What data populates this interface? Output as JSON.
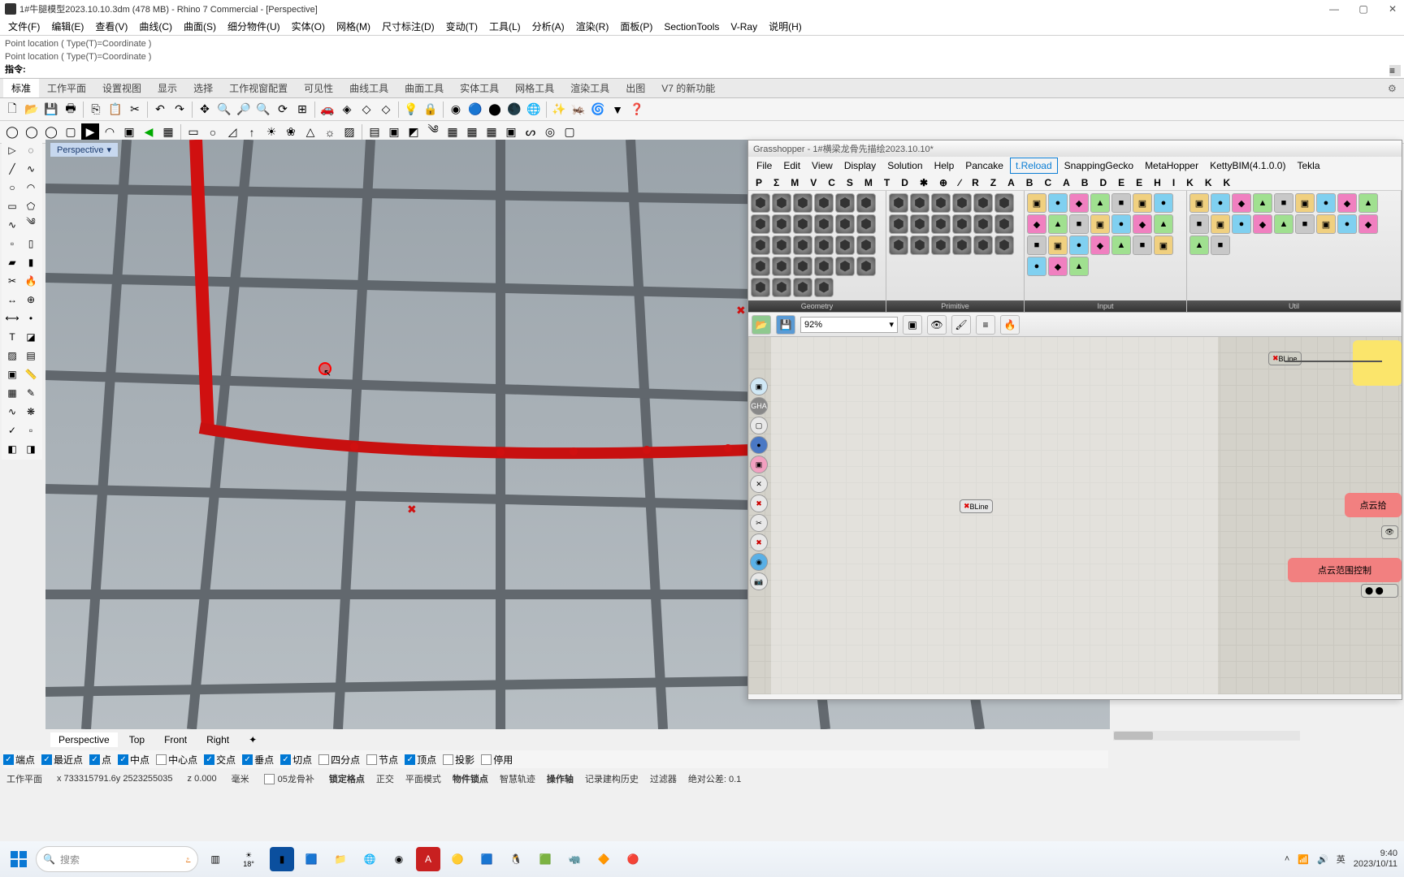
{
  "titlebar": {
    "title": "1#牛腿模型2023.10.10.3dm (478 MB) - Rhino 7 Commercial - [Perspective]"
  },
  "rhino_menu": [
    "文件(F)",
    "编辑(E)",
    "查看(V)",
    "曲线(C)",
    "曲面(S)",
    "细分物件(U)",
    "实体(O)",
    "网格(M)",
    "尺寸标注(D)",
    "变动(T)",
    "工具(L)",
    "分析(A)",
    "渲染(R)",
    "面板(P)",
    "SectionTools",
    "V-Ray",
    "说明(H)"
  ],
  "command_history": [
    "Point location ( Type(T)=Coordinate )",
    "Point location ( Type(T)=Coordinate )"
  ],
  "command_prompt": "指令:",
  "rhino_tabs": [
    "标准",
    "工作平面",
    "设置视图",
    "显示",
    "选择",
    "工作视窗配置",
    "可见性",
    "曲线工具",
    "曲面工具",
    "实体工具",
    "网格工具",
    "渲染工具",
    "出图",
    "V7 的新功能"
  ],
  "viewport": {
    "title": "Perspective",
    "dropdown": "▾"
  },
  "view_tabs": [
    "Perspective",
    "Top",
    "Front",
    "Right",
    "✦"
  ],
  "osnap": [
    {
      "label": "端点",
      "checked": true
    },
    {
      "label": "最近点",
      "checked": true
    },
    {
      "label": "点",
      "checked": true
    },
    {
      "label": "中点",
      "checked": true
    },
    {
      "label": "中心点",
      "checked": false
    },
    {
      "label": "交点",
      "checked": true
    },
    {
      "label": "垂点",
      "checked": true
    },
    {
      "label": "切点",
      "checked": true
    },
    {
      "label": "四分点",
      "checked": false
    },
    {
      "label": "节点",
      "checked": false
    },
    {
      "label": "顶点",
      "checked": true
    },
    {
      "label": "投影",
      "checked": false
    },
    {
      "label": "停用",
      "checked": false
    }
  ],
  "status": {
    "plane": "工作平面",
    "x": "x 733315791.6y 2523255035",
    "z": "z 0.000",
    "unit": "毫米",
    "layer_chk": false,
    "layer": "05龙骨补",
    "toggles": [
      "锁定格点",
      "正交",
      "平面模式",
      "物件锁点",
      "智慧轨迹",
      "操作轴",
      "记录建构历史",
      "过滤器",
      "绝对公差: 0.1"
    ]
  },
  "gh": {
    "title": "Grasshopper - 1#横梁龙骨先描绘2023.10.10*",
    "menu": [
      "File",
      "Edit",
      "View",
      "Display",
      "Solution",
      "Help",
      "Pancake",
      "t.Reload",
      "SnappingGecko",
      "MetaHopper",
      "KettyBIM(4.1.0.0)",
      "Tekla"
    ],
    "ribbon_tabs": [
      "P",
      "Σ",
      "M",
      "V",
      "C",
      "S",
      "M",
      "T",
      "D",
      "✱",
      "⊕",
      "∕",
      "R",
      "Z",
      "A",
      "B",
      "C",
      "A",
      "B",
      "D",
      "E",
      "E",
      "H",
      "I",
      "K",
      "K",
      "K"
    ],
    "groups": [
      "Geometry",
      "Primitive",
      "Input",
      "Util"
    ],
    "zoom": "92%",
    "canvas_nodes": {
      "n1": "BLine",
      "n2": "BLine",
      "label1": "点云拾",
      "label2": "点云范围控制"
    }
  },
  "taskbar": {
    "search_placeholder": "搜索",
    "weather": "18°",
    "weather_sub": "",
    "time": "9:40",
    "date": "2023/10/11"
  }
}
